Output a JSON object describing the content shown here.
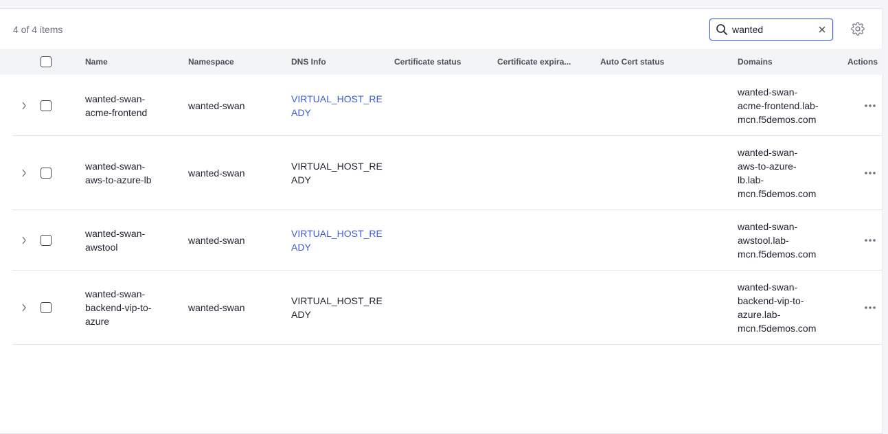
{
  "toolbar": {
    "item_count": "4 of 4 items",
    "search_value": "wanted",
    "search_icon": "search-icon",
    "clear_icon": "close-icon",
    "settings_icon": "gear-icon"
  },
  "table": {
    "columns": {
      "name": "Name",
      "namespace": "Namespace",
      "dns_info": "DNS Info",
      "certificate_status": "Certificate status",
      "certificate_expiration": "Certificate expira...",
      "auto_cert_status": "Auto Cert status",
      "domains": "Domains",
      "actions": "Actions"
    },
    "rows": [
      {
        "name": [
          "wanted-swan-",
          "acme-frontend"
        ],
        "namespace": "wanted-swan",
        "dns": [
          "VIRTUAL_HOST_RE",
          "ADY"
        ],
        "dns_link": true,
        "domains": [
          "wanted-swan-",
          "acme-frontend.lab-",
          "mcn.f5demos.com"
        ]
      },
      {
        "name": [
          "wanted-swan-",
          "aws-to-azure-lb"
        ],
        "namespace": "wanted-swan",
        "dns": [
          "VIRTUAL_HOST_RE",
          "ADY"
        ],
        "dns_link": false,
        "domains": [
          "wanted-swan-",
          "aws-to-azure-",
          "lb.lab-",
          "mcn.f5demos.com"
        ]
      },
      {
        "name": [
          "wanted-swan-",
          "awstool"
        ],
        "namespace": "wanted-swan",
        "dns": [
          "VIRTUAL_HOST_RE",
          "ADY"
        ],
        "dns_link": true,
        "domains": [
          "wanted-swan-",
          "awstool.lab-",
          "mcn.f5demos.com"
        ]
      },
      {
        "name": [
          "wanted-swan-",
          "backend-vip-to-",
          "azure"
        ],
        "namespace": "wanted-swan",
        "dns": [
          "VIRTUAL_HOST_RE",
          "ADY"
        ],
        "dns_link": false,
        "domains": [
          "wanted-swan-",
          "backend-vip-to-",
          "azure.lab-",
          "mcn.f5demos.com"
        ]
      }
    ]
  },
  "colors": {
    "accent": "#3b5bdb",
    "header_bg": "#f3f4f6",
    "border": "#e3e5ea"
  }
}
